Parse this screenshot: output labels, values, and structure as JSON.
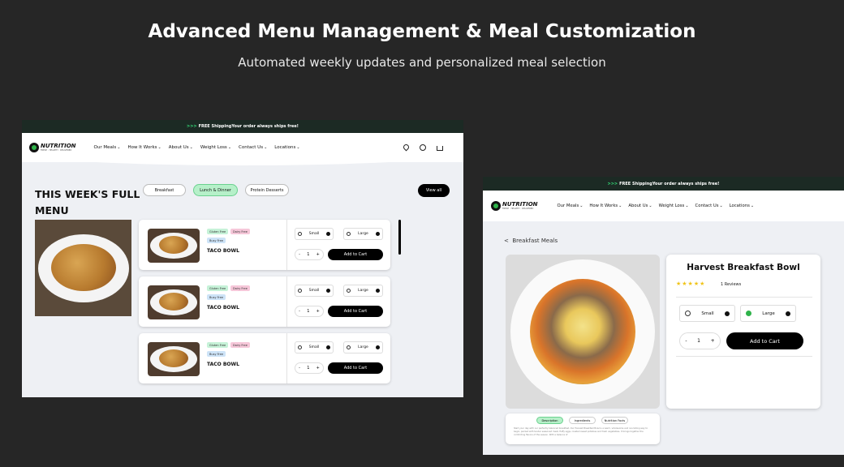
{
  "heading": {
    "title": "Advanced Menu Management & Meal Customization",
    "subtitle": "Automated weekly updates and personalized meal selection"
  },
  "shared": {
    "promo_arrows": ">>>",
    "promo_text": "FREE ShippingYour order always ships free!",
    "logo_text": "NUTRITION",
    "logo_sub": "FRESH · HEALTHY · DELIVERED",
    "nav": [
      "Our Meals",
      "How It Works",
      "About Us",
      "Weight Loss",
      "Contact Us",
      "Locations"
    ],
    "chev": "⌄"
  },
  "menu_page": {
    "title": "THIS WEEK'S FULL MENU",
    "filters": [
      "Breakfast",
      "Lunch & Dinner",
      "Protein Desserts"
    ],
    "active_filter": "Lunch & Dinner",
    "view_all": "View all",
    "items": [
      {
        "tags": [
          "Gluten Free",
          "Dairy Free",
          "Busy Free"
        ],
        "name": "TACO BOWL",
        "size_small": "Small",
        "size_large": "Large",
        "qty": "1",
        "minus": "-",
        "plus": "+",
        "cta": "Add to Cart"
      },
      {
        "tags": [
          "Gluten Free",
          "Dairy Free",
          "Busy Free"
        ],
        "name": "TACO BOWL",
        "size_small": "Small",
        "size_large": "Large",
        "qty": "1",
        "minus": "-",
        "plus": "+",
        "cta": "Add to Cart"
      },
      {
        "tags": [
          "Gluten Free",
          "Dairy Free",
          "Busy Free"
        ],
        "name": "TACO BOWL",
        "size_small": "Small",
        "size_large": "Large",
        "qty": "1",
        "minus": "-",
        "plus": "+",
        "cta": "Add to Cart"
      }
    ]
  },
  "product_page": {
    "back": "<",
    "crumb": "Breakfast Meals",
    "title": "Harvest Breakfast Bowl",
    "stars": "★★★★★",
    "rating": 5,
    "reviews": "1 Reviews",
    "size_small": "Small",
    "size_large": "Large",
    "selected_size": "Large",
    "qty": "1",
    "minus": "-",
    "plus": "+",
    "cta": "Add to Cart",
    "tabs": [
      "Description",
      "Ingredients",
      "Nutrition Facts"
    ],
    "active_tab": "Description",
    "description": "Start your day with our perfectly balanced breakfast. Our Harvest Breakfast Bowl is a warm, wholesome and nourishing way to begin, packed with tender seasoned meat, fluffy eggs, roasted sweet potatoes and fresh vegetables. It brings together the comforting flavors of the season. With a balance of"
  },
  "colors": {
    "accent": "#35e07a",
    "active_pill": "#b6f0c9",
    "button": "#000000",
    "star": "#f0c419"
  }
}
